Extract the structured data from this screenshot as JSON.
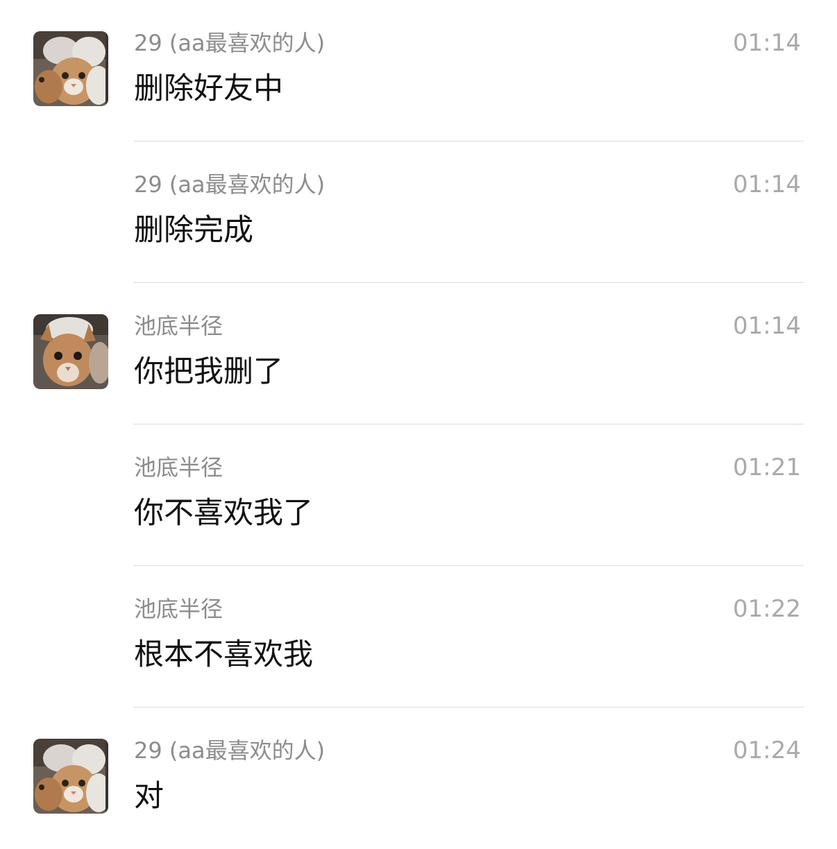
{
  "messages": [
    {
      "sender": "29 (aa最喜欢的人)",
      "time": "01:14",
      "text": "删除好友中",
      "avatar": "cat-avatar-a"
    },
    {
      "sender": "29 (aa最喜欢的人)",
      "time": "01:14",
      "text": "删除完成",
      "avatar": null
    },
    {
      "sender": "池底半径",
      "time": "01:14",
      "text": "你把我删了",
      "avatar": "cat-avatar-b"
    },
    {
      "sender": "池底半径",
      "time": "01:21",
      "text": "你不喜欢我了",
      "avatar": null
    },
    {
      "sender": "池底半径",
      "time": "01:22",
      "text": "根本不喜欢我",
      "avatar": null
    },
    {
      "sender": "29 (aa最喜欢的人)",
      "time": "01:24",
      "text": "对",
      "avatar": "cat-avatar-a"
    }
  ],
  "colors": {
    "background": "#ffffff",
    "sender_text": "#8c8c8c",
    "time_text": "#a9a9a9",
    "message_text": "#111111",
    "divider": "#dcdcdc"
  }
}
